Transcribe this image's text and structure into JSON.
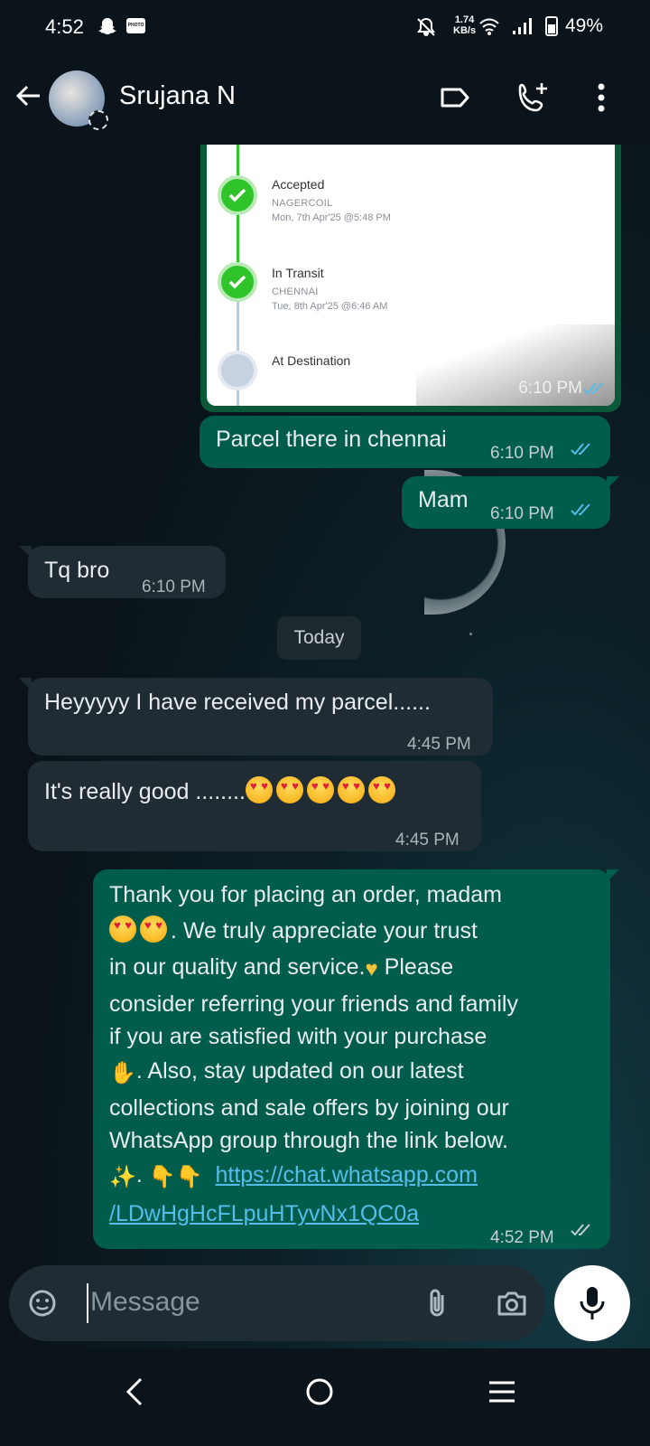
{
  "status_bar": {
    "time": "4:52",
    "net_speed_value": "1.74",
    "net_speed_unit": "KB/s",
    "battery": "49%",
    "badge_text": "PHOTO"
  },
  "header": {
    "contact_name": "Srujana N"
  },
  "tracking_card": {
    "steps": [
      {
        "title": "Accepted",
        "location": "NAGERCOIL",
        "date": "Mon, 7th Apr'25 @5:48 PM",
        "done": true
      },
      {
        "title": "In Transit",
        "location": "CHENNAI",
        "date": "Tue, 8th Apr'25 @6:46 AM",
        "done": true
      },
      {
        "title": "At Destination",
        "location": "",
        "date": "",
        "done": false
      }
    ],
    "time": "6:10 PM",
    "read": true
  },
  "messages": [
    {
      "id": "m1",
      "dir": "out",
      "text": "Parcel there in chennai",
      "time": "6:10 PM",
      "read": true
    },
    {
      "id": "m2",
      "dir": "out",
      "text": "Mam",
      "time": "6:10 PM",
      "read": true
    },
    {
      "id": "m3",
      "dir": "in",
      "text": "Tq bro",
      "time": "6:10 PM"
    },
    {
      "id": "m4",
      "dir": "in",
      "text": "Heyyyyy I have received my parcel......",
      "time": "4:45 PM"
    },
    {
      "id": "m5",
      "dir": "in",
      "text": "It's really good ........",
      "emoji_count": 5,
      "time": "4:45 PM"
    },
    {
      "id": "m6",
      "dir": "out",
      "lines": [
        "Thank you for placing an order, madam",
        ". We truly appreciate your trust",
        "in our quality and service.",
        " Please",
        "consider referring your friends and family",
        "if you are satisfied with your purchase",
        ". Also, stay updated on our latest",
        "collections and sale offers by joining our",
        "WhatsApp group through the link below.",
        ". "
      ],
      "link_line1": "https://chat.whatsapp.com",
      "link_line2": "/LDwHgHcFLpuHTyvNx1QC0a",
      "time": "4:52 PM",
      "read": false
    }
  ],
  "date_divider": "Today",
  "composer": {
    "placeholder": "Message"
  },
  "colors": {
    "outgoing_bubble": "#005c4b",
    "incoming_bubble": "#202c33",
    "read_tick": "#53bdeb",
    "link": "#53bdeb",
    "timeline_done": "#2fc42a"
  }
}
